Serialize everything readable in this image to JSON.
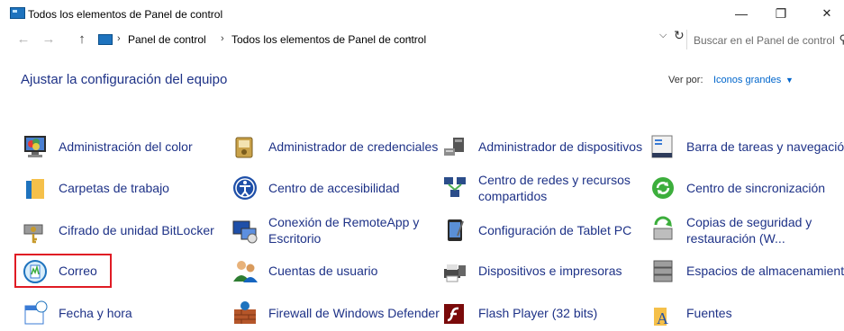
{
  "window": {
    "title": "Todos los elementos de Panel de control",
    "minimize": "—",
    "maximize": "❐",
    "close": "✕"
  },
  "nav": {
    "back": "←",
    "forward": "→",
    "up": "↑"
  },
  "address": {
    "crumbs": [
      "Panel de control",
      "Todos los elementos de Panel de control"
    ],
    "separator": "›",
    "dropdown": "⌵",
    "refresh": "↻"
  },
  "search": {
    "placeholder": "Buscar en el Panel de control",
    "icon": "⚲"
  },
  "header": {
    "title": "Ajustar la configuración del equipo",
    "view_by_label": "Ver por:",
    "view_by_value": "Iconos grandes",
    "caret": "▼"
  },
  "items": [
    {
      "label": "Administración del color",
      "icon": "color-management-icon"
    },
    {
      "label": "Administrador de credenciales",
      "icon": "credential-manager-icon"
    },
    {
      "label": "Administrador de dispositivos",
      "icon": "device-manager-icon"
    },
    {
      "label": "Barra de tareas y navegación",
      "icon": "taskbar-icon"
    },
    {
      "label": "Carpetas de trabajo",
      "icon": "work-folders-icon"
    },
    {
      "label": "Centro de accesibilidad",
      "icon": "ease-of-access-icon"
    },
    {
      "label": "Centro de redes y recursos compartidos",
      "icon": "network-center-icon"
    },
    {
      "label": "Centro de sincronización",
      "icon": "sync-center-icon"
    },
    {
      "label": "Cifrado de unidad BitLocker",
      "icon": "bitlocker-icon"
    },
    {
      "label": "Conexión de RemoteApp y Escritorio",
      "icon": "remoteapp-icon"
    },
    {
      "label": "Configuración de Tablet PC",
      "icon": "tablet-pc-icon"
    },
    {
      "label": "Copias de seguridad y restauración (W...",
      "icon": "backup-restore-icon"
    },
    {
      "label": "Correo",
      "icon": "mail-icon"
    },
    {
      "label": "Cuentas de usuario",
      "icon": "user-accounts-icon"
    },
    {
      "label": "Dispositivos e impresoras",
      "icon": "devices-printers-icon"
    },
    {
      "label": "Espacios de almacenamiento",
      "icon": "storage-spaces-icon"
    },
    {
      "label": "Fecha y hora",
      "icon": "date-time-icon"
    },
    {
      "label": "Firewall de Windows Defender",
      "icon": "firewall-icon"
    },
    {
      "label": "Flash Player (32 bits)",
      "icon": "flash-player-icon"
    },
    {
      "label": "Fuentes",
      "icon": "fonts-icon"
    }
  ],
  "colors": {
    "link": "#1e3287",
    "accent": "#0066cc",
    "highlight_border": "#e01b24"
  }
}
